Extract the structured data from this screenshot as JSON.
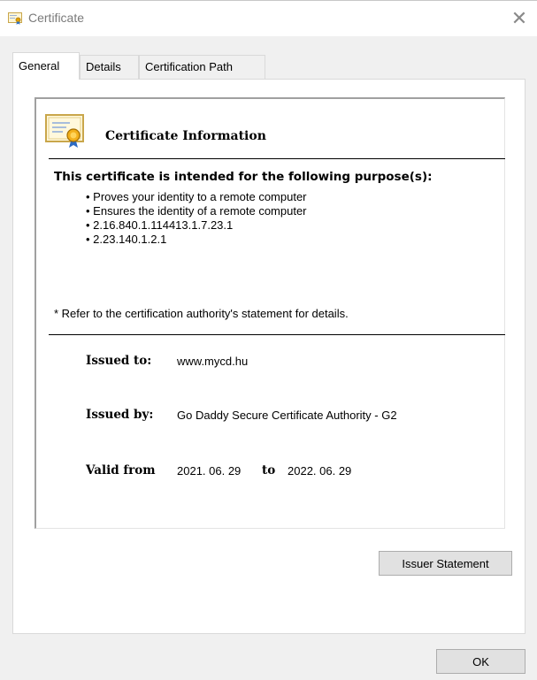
{
  "window": {
    "title": "Certificate",
    "close_symbol": "✕"
  },
  "tabs": [
    {
      "label": "General",
      "active": true
    },
    {
      "label": "Details",
      "active": false
    },
    {
      "label": "Certification Path",
      "active": false
    }
  ],
  "info": {
    "heading": "Certificate Information",
    "purpose_title": "This certificate is intended for the following purpose(s):",
    "purposes": [
      "Proves your identity to a remote computer",
      "Ensures the identity of a remote computer",
      "2.16.840.1.114413.1.7.23.1",
      "2.23.140.1.2.1"
    ],
    "footnote": "* Refer to the certification authority's statement for details."
  },
  "fields": {
    "issued_to_label": "Issued to:",
    "issued_to_value": "www.mycd.hu",
    "issued_by_label": "Issued by:",
    "issued_by_value": "Go Daddy Secure Certificate Authority - G2",
    "valid_from_label": "Valid from",
    "valid_from_value": "2021. 06. 29",
    "valid_to_label": "to",
    "valid_to_value": "2022. 06. 29"
  },
  "buttons": {
    "issuer_statement": "Issuer Statement",
    "ok": "OK"
  }
}
